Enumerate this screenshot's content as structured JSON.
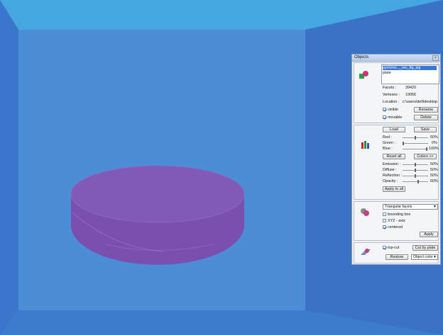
{
  "panel": {
    "title": "Objects",
    "close_icon": "close-icon",
    "object_list": [
      "pyrromo..._rec_fig_sig",
      "plate"
    ],
    "info": {
      "facets_label": "Facets :",
      "facets_value": "39420",
      "vertexes_label": "Vertexes :",
      "vertexes_value": "19056",
      "location_label": "Location :",
      "location_value": "c:\\users\\dell\\desktop"
    },
    "visible_label": "visible",
    "movable_label": "movable",
    "rename_label": "Rename",
    "delete_label": "Delete",
    "load_label": "Load",
    "save_label": "Save",
    "colors": [
      {
        "label": "Red :",
        "value": "50%",
        "level": 0.5
      },
      {
        "label": "Green :",
        "value": "0%",
        "level": 0.0
      },
      {
        "label": "Blue :",
        "value": "100%",
        "level": 1.0
      }
    ],
    "reset_all_label": "Reset all",
    "colors_button_label": "Colors >>",
    "lighting": [
      {
        "label": "Emission :",
        "value": "50%",
        "level": 0.5
      },
      {
        "label": "Diffuse :",
        "value": "50%",
        "level": 0.5
      },
      {
        "label": "Reflection :",
        "value": "50%",
        "level": 0.5
      },
      {
        "label": "Opacity :",
        "value": "60%",
        "level": 0.6
      }
    ],
    "apply_to_all_label": "Apply to all",
    "render_mode": "Triangular facets",
    "bounding_box_label": "bounding box",
    "xyz_axis_label": "XYZ - axis",
    "centered_label": "centered",
    "apply_label": "Apply",
    "top_cut_label": "top-cut",
    "cut_by_plate_label": "Cut by plate",
    "restore_label": "Restore",
    "object_color_label": "Object color"
  },
  "checks": {
    "visible": true,
    "movable": true,
    "bounding_box": false,
    "xyz_axis": false,
    "centered": true,
    "top_cut": true
  },
  "colors": {
    "box_back": "#4a8fd6",
    "box_top": "#43a6e0",
    "object": "#7e54b3"
  }
}
